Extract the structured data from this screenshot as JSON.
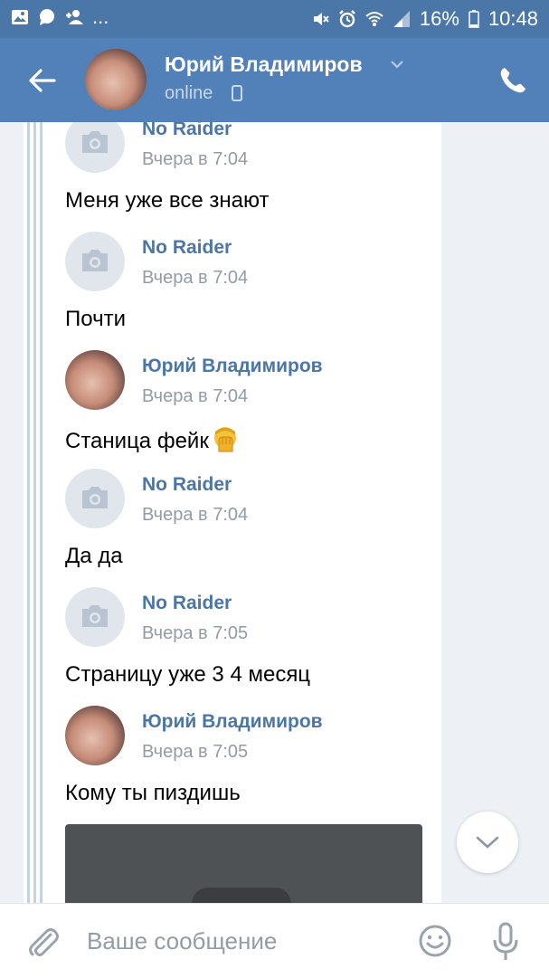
{
  "status_bar": {
    "notification_icons": [
      "image-icon",
      "chat-bubble-icon",
      "add-friend-icon"
    ],
    "overflow": "...",
    "battery_percent": "16%",
    "time": "10:48",
    "system_icons": [
      "mute-icon",
      "alarm-icon",
      "wifi-icon",
      "signal-icon",
      "battery-icon"
    ]
  },
  "header": {
    "name": "Юрий Владимиров",
    "status": "online"
  },
  "messages": [
    {
      "sender": "No Raider",
      "time": "Вчера в 7:04",
      "text": "Меня уже все знают",
      "avatar": "placeholder"
    },
    {
      "sender": "No Raider",
      "time": "Вчера в 7:04",
      "text": "Почти",
      "avatar": "placeholder"
    },
    {
      "sender": "Юрий Владимиров",
      "time": "Вчера в 7:04",
      "text": "Станица фейк",
      "emoji": "face-palm",
      "avatar": "photo"
    },
    {
      "sender": "No Raider",
      "time": "Вчера в 7:04",
      "text": "Да да",
      "avatar": "placeholder"
    },
    {
      "sender": "No Raider",
      "time": "Вчера в 7:05",
      "text": "Страницу уже 3 4 месяц",
      "avatar": "placeholder"
    },
    {
      "sender": "Юрий Владимиров",
      "time": "Вчера в 7:05",
      "text": "Кому ты пиздишь",
      "avatar": "photo"
    }
  ],
  "composer": {
    "placeholder": "Ваше сообщение"
  },
  "colors": {
    "header": "#5181b8",
    "status_bar": "#4a76a8",
    "name_link": "#4a76a8",
    "muted": "#939ba5",
    "background": "#edf0f5"
  }
}
